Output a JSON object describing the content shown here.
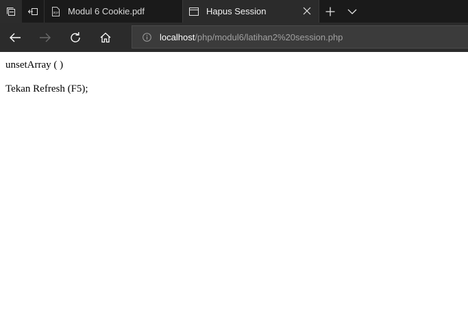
{
  "browser": {
    "tabs": [
      {
        "title": "Modul 6 Cookie.pdf",
        "icon": "pdf-icon",
        "active": false
      },
      {
        "title": "Hapus Session",
        "icon": "page-icon",
        "active": true
      }
    ],
    "address": {
      "host": "localhost",
      "path": "/php/modul6/latihan2%20session.php"
    },
    "colors": {
      "chrome_dark": "#1a1a1a",
      "chrome": "#2b2b2b",
      "address_field": "#3b3b3b"
    }
  },
  "page": {
    "lines": [
      "unsetArray ( )",
      "Tekan Refresh (F5);"
    ]
  }
}
